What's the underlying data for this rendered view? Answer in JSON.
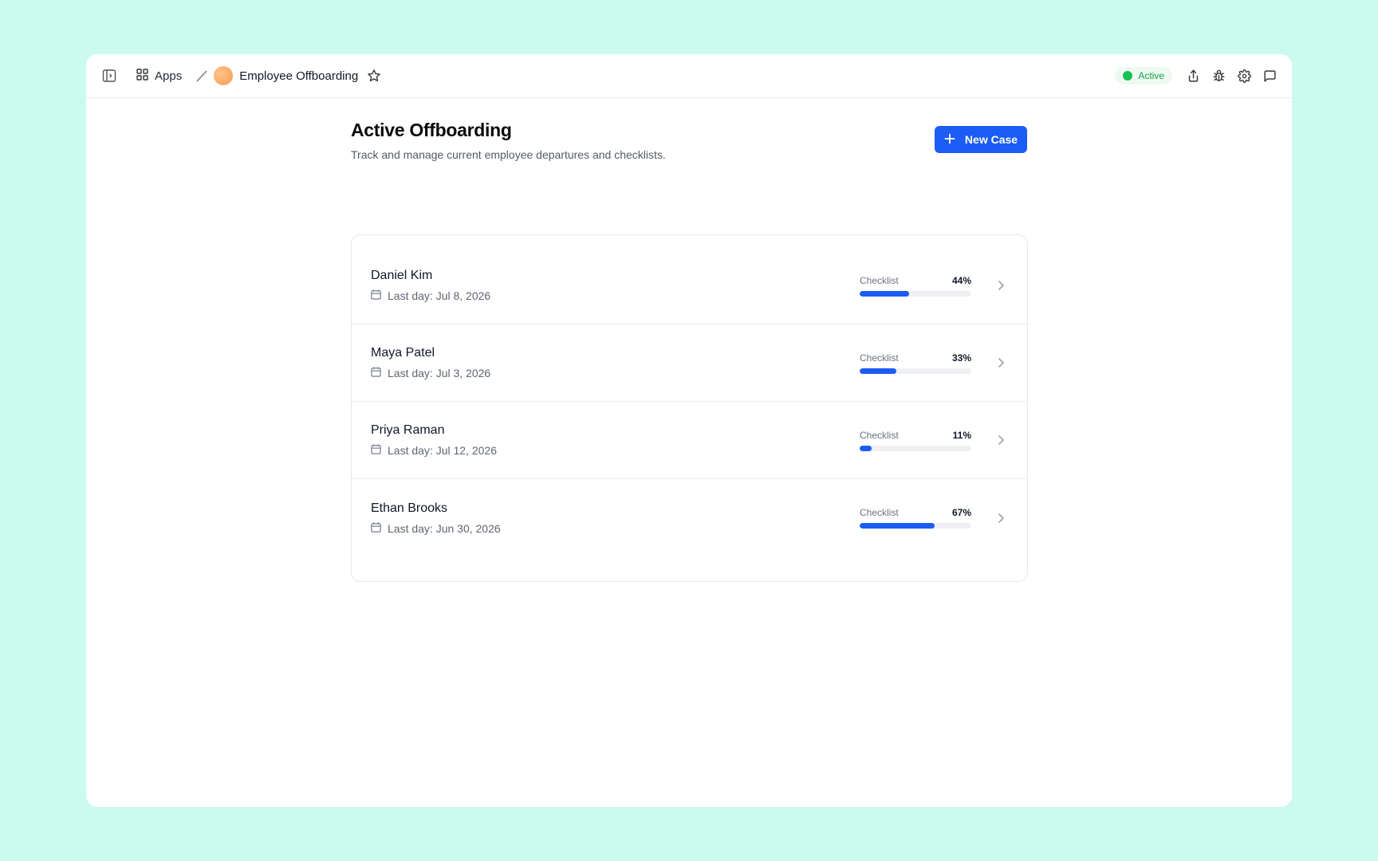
{
  "topbar": {
    "apps_label": "Apps",
    "app_name": "Employee Offboarding",
    "status": "Active"
  },
  "page": {
    "title": "Active Offboarding",
    "subtitle": "Track and manage current employee departures and checklists.",
    "new_case_label": "New Case"
  },
  "employees": [
    {
      "name": "Daniel Kim",
      "last_day": "Last day: Jul 8, 2026",
      "checklist_label": "Checklist",
      "percent_text": "44%",
      "progress": 0.44
    },
    {
      "name": "Maya Patel",
      "last_day": "Last day: Jul 3, 2026",
      "checklist_label": "Checklist",
      "percent_text": "33%",
      "progress": 0.33
    },
    {
      "name": "Priya Raman",
      "last_day": "Last day: Jul 12, 2026",
      "checklist_label": "Checklist",
      "percent_text": "11%",
      "progress": 0.11
    },
    {
      "name": "Ethan Brooks",
      "last_day": "Last day: Jun 30, 2026",
      "checklist_label": "Checklist",
      "percent_text": "67%",
      "progress": 0.67
    }
  ],
  "colors": {
    "background": "#ccfaee",
    "accent": "#1b5cf5",
    "status_green": "#16c153"
  },
  "icons": [
    "sidebar-toggle-icon",
    "apps-grid-icon",
    "star-icon",
    "share-icon",
    "bug-icon",
    "gear-icon",
    "chat-icon",
    "plus-icon",
    "calendar-icon",
    "chevron-right-icon"
  ]
}
